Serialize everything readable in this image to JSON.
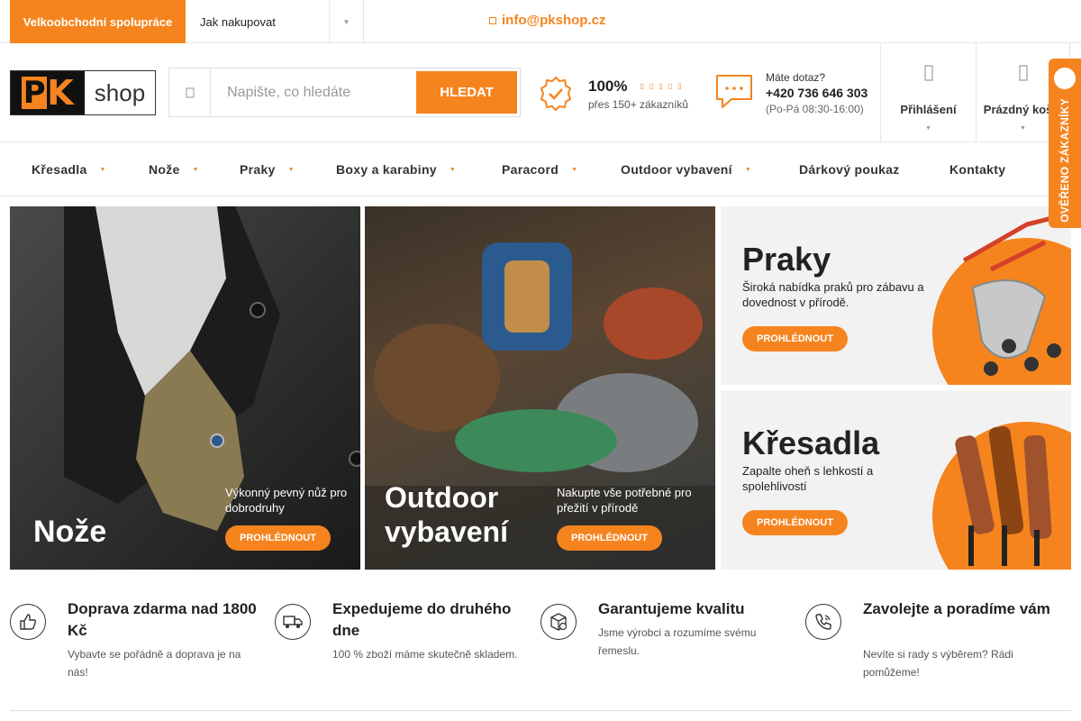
{
  "topbar": {
    "wholesale_label": "Velkoobchodní spolupráce",
    "howto_label": "Jak nakupovat",
    "email": "info@pkshop.cz"
  },
  "logo": {
    "mark": "PK",
    "word": "shop"
  },
  "search": {
    "placeholder": "Napište, co hledáte",
    "value": "",
    "button": "HLEDAT"
  },
  "rating": {
    "percent": "100%",
    "stars": 5,
    "sub": "přes 150+ zákazníků"
  },
  "contact": {
    "question": "Máte dotaz?",
    "phone": "+420 736 646 303",
    "hours": "(Po-Pá 08:30-16:00)"
  },
  "account": {
    "login_label": "Přihlášení",
    "cart_label": "Prázdný košík"
  },
  "badge": {
    "text": "OVĚŘENO ZÁKAZNÍKY"
  },
  "nav": [
    {
      "label": "Křesadla",
      "dropdown": true
    },
    {
      "label": "Nože",
      "dropdown": true
    },
    {
      "label": "Praky",
      "dropdown": true
    },
    {
      "label": "Boxy a karabiny",
      "dropdown": true
    },
    {
      "label": "Paracord",
      "dropdown": true
    },
    {
      "label": "Outdoor vybavení",
      "dropdown": true
    },
    {
      "label": "Dárkový poukaz",
      "dropdown": false
    },
    {
      "label": "Kontakty",
      "dropdown": false
    }
  ],
  "banners": {
    "knife": {
      "title": "Nože",
      "sub": "Výkonný pevný nůž pro dobrodruhy",
      "button": "PROHLÉDNOUT"
    },
    "outdoor": {
      "title": "Outdoor vybavení",
      "sub": "Nakupte vše potřebné pro přežití v přírodě",
      "button": "PROHLÉDNOUT"
    },
    "praky": {
      "title": "Praky",
      "sub": "Široká nabídka praků pro zábavu a dovednost v přírodě.",
      "button": "PROHLÉDNOUT"
    },
    "kresadla": {
      "title": "Křesadla",
      "sub": "Zapalte oheň s lehkostí a spolehlivostí",
      "button": "PROHLÉDNOUT"
    }
  },
  "features": [
    {
      "icon": "thumbs-up-icon",
      "title": "Doprava zdarma nad 1800 Kč",
      "desc": "Vybavte se pořádně a doprava je na nás!"
    },
    {
      "icon": "delivery-truck-icon",
      "title": "Expedujeme do druhého dne",
      "desc": "100 % zboží máme skutečně skladem."
    },
    {
      "icon": "quality-box-icon",
      "title": "Garantujeme kvalitu",
      "desc": "Jsme výrobci a rozumíme svému řemeslu."
    },
    {
      "icon": "phone-icon",
      "title": "Zavolejte a poradíme vám",
      "desc": "Nevíte si rady s výběrem? Rádi pomůžeme!"
    }
  ],
  "colors": {
    "accent": "#f5841f",
    "text": "#222222",
    "border": "#e6e6e6"
  }
}
